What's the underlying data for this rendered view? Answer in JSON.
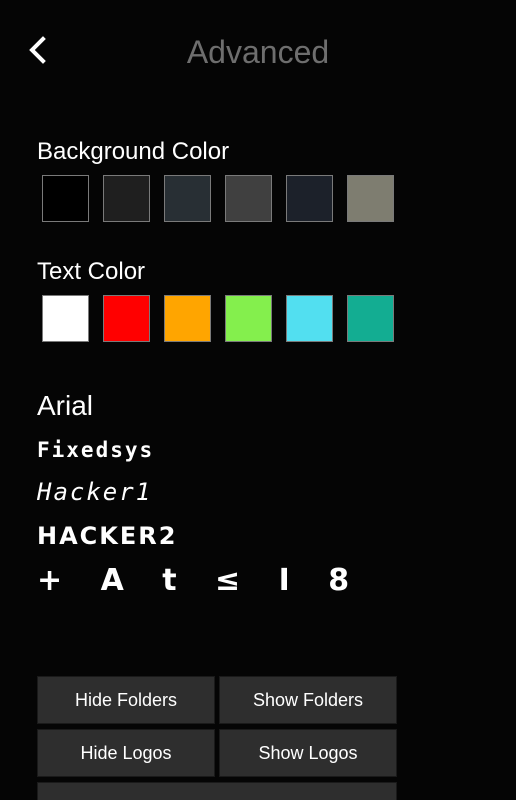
{
  "header": {
    "title": "Advanced",
    "back_icon": "chevron-left-icon"
  },
  "background_color": {
    "label": "Background Color",
    "swatches": [
      "#000000",
      "#1f1f1f",
      "#282f34",
      "#404040",
      "#1c212a",
      "#7e7d70"
    ]
  },
  "text_color": {
    "label": "Text Color",
    "swatches": [
      "#ffffff",
      "#ff0000",
      "#ffa500",
      "#84ef4d",
      "#52dff0",
      "#13ad92"
    ]
  },
  "fonts": {
    "arial": "Arial",
    "fixedsys": "Fixedsys",
    "hacker1": "Hacker1",
    "hacker2": "HACKER2",
    "glyphs": "+ A t ≤ I 8"
  },
  "buttons": {
    "hide_folders": "Hide Folders",
    "show_folders": "Show Folders",
    "hide_logos": "Hide Logos",
    "show_logos": "Show Logos"
  }
}
